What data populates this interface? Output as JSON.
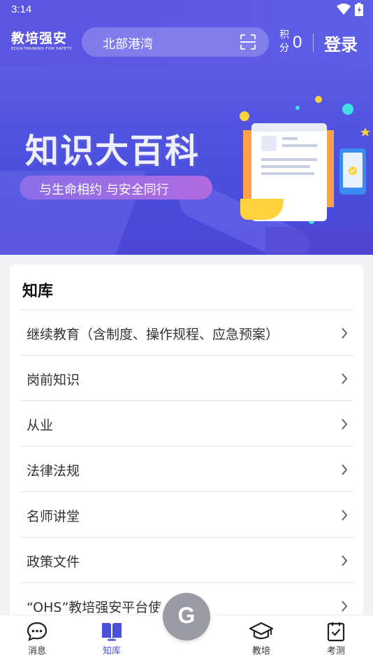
{
  "status_bar": {
    "time": "3:14"
  },
  "header": {
    "logo_cn": "教培强安",
    "logo_en": "EDU&TRAINING FOR SAFETY",
    "search_location": "北部港湾",
    "points_label": "积分",
    "points_value": "0",
    "login_label": "登录"
  },
  "banner": {
    "title": "知识大百科",
    "slogan": "与生命相约 与安全同行"
  },
  "knowledge": {
    "heading": "知库",
    "items": [
      {
        "label": "继续教育（含制度、操作规程、应急预案）"
      },
      {
        "label": "岗前知识"
      },
      {
        "label": "从业"
      },
      {
        "label": "法律法规"
      },
      {
        "label": "名师讲堂"
      },
      {
        "label": "政策文件"
      },
      {
        "label": "“OHS”教培强安平台使用培训"
      }
    ]
  },
  "bottom_nav": {
    "items": [
      {
        "label": "消息",
        "icon": "message-icon"
      },
      {
        "label": "知库",
        "icon": "book-icon",
        "active": true
      },
      {
        "label": "教培",
        "icon": "graduation-cap-icon"
      },
      {
        "label": "考测",
        "icon": "clipboard-check-icon"
      }
    ],
    "fab_label": "G"
  },
  "colors": {
    "brand": "#5b5be6",
    "active_tab": "#4b50d9",
    "fab": "#9b9ba6",
    "page_background": "#f2f2f5"
  }
}
